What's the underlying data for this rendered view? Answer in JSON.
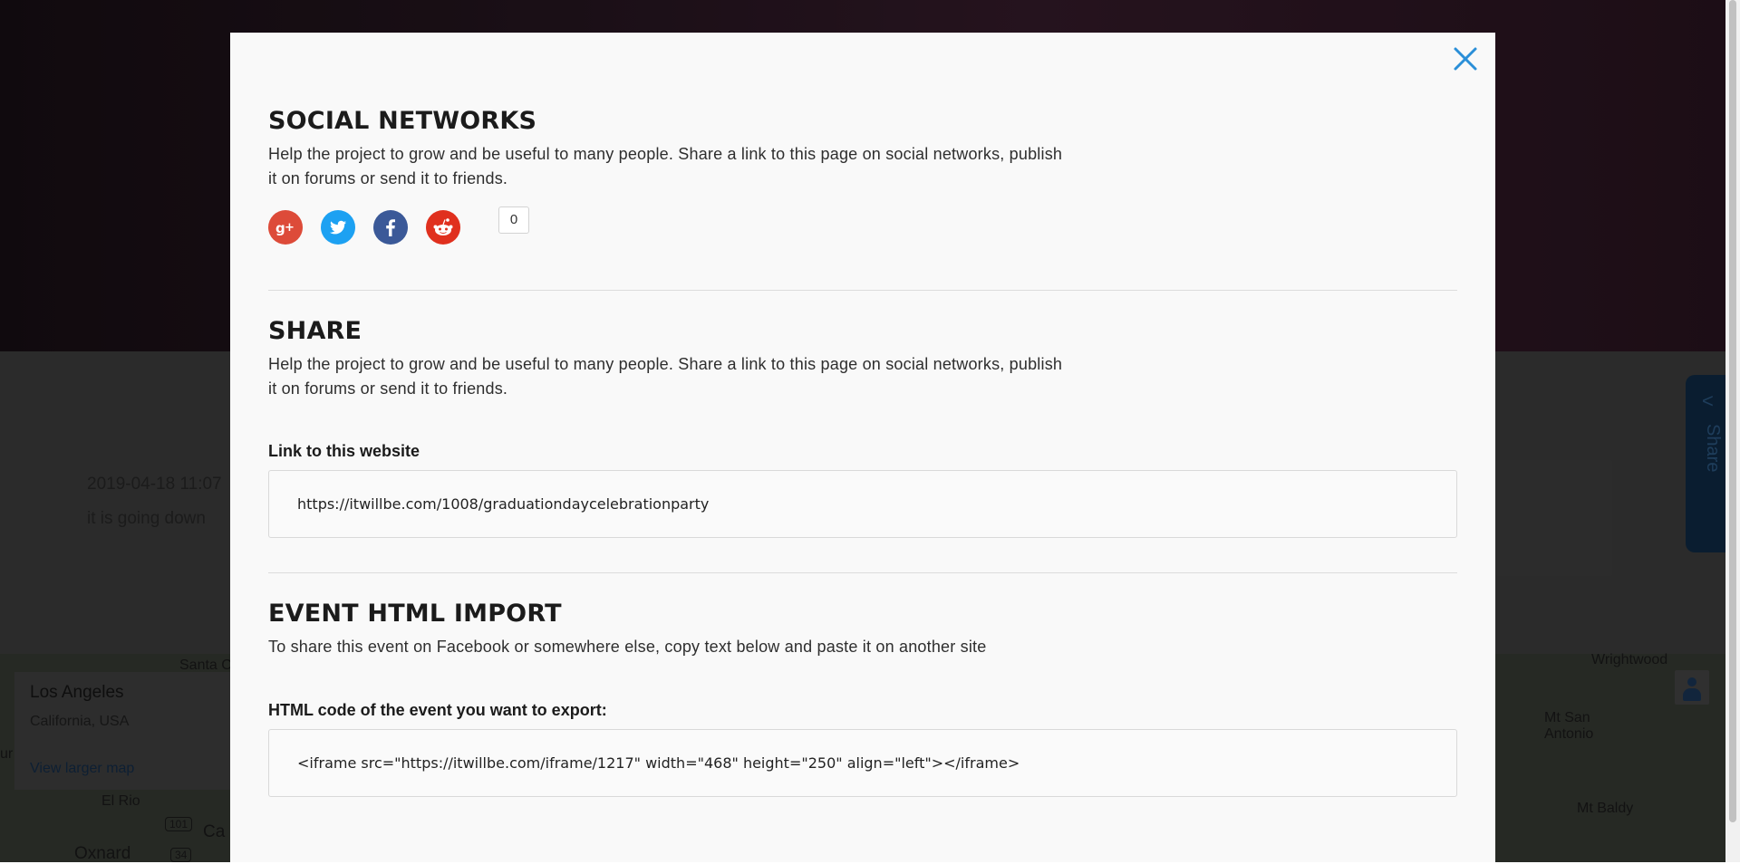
{
  "background": {
    "event_date": "2019-04-18 11:07",
    "event_description": "it is going down",
    "share_tab_label": "Share",
    "map": {
      "title": "Los Angeles",
      "subtitle": "California, USA",
      "larger_map_link": "View larger map",
      "labels": [
        "Santa C",
        "El Rio",
        "Ca",
        "Oxnard",
        "ur",
        "Wrightwood",
        "Mt San",
        "Antonio",
        "Mt Baldy"
      ],
      "routes": [
        "101",
        "34"
      ]
    }
  },
  "modal": {
    "close_icon": "close-icon",
    "social_networks": {
      "title": "SOCIAL NETWORKS",
      "description": "Help the project to grow and be useful to many people. Share a link to this page on social networks, publish it on forums or send it to friends.",
      "buttons": [
        {
          "name": "google-plus",
          "color": "#dd4b39"
        },
        {
          "name": "twitter",
          "color": "#1da1f2"
        },
        {
          "name": "facebook",
          "color": "#3b5998"
        },
        {
          "name": "reddit",
          "color": "#e0301e"
        }
      ],
      "share_count": "0"
    },
    "share": {
      "title": "SHARE",
      "description": "Help the project to grow and be useful to many people. Share a link to this page on social networks, publish it on forums or send it to friends.",
      "link_label": "Link to this website",
      "link_value": "https://itwillbe.com/1008/graduationdaycelebrationparty"
    },
    "event_import": {
      "title": "EVENT HTML IMPORT",
      "description": "To share this event on Facebook or somewhere else, copy text below and paste it on another site",
      "code_label": "HTML code of the event you want to export:",
      "code_value": "<iframe src=\"https://itwillbe.com/iframe/1217\" width=\"468\" height=\"250\" align=\"left\"></iframe>"
    }
  },
  "colors": {
    "accent": "#2a8fd8",
    "modal_bg": "#f9f9f9"
  }
}
